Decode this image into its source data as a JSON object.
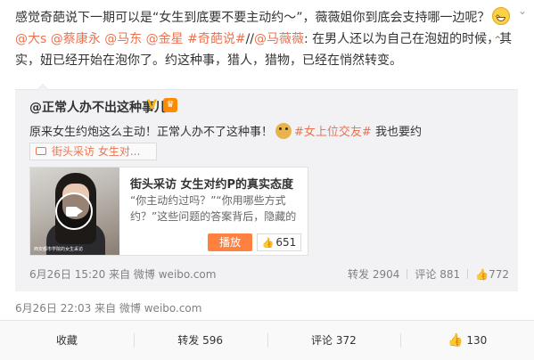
{
  "post": {
    "text_before": "感觉奇葩说下一期可以是“女生到底要不要主动约～”，薇薇姐你到底会支持哪一边呢？",
    "mentions": [
      "@大s",
      "@蔡康永",
      "@马东",
      "@金星"
    ],
    "topic": "#奇葩说#",
    "repost_sep": "//",
    "repost_user": "@马薇薇",
    "repost_text": ": 在男人还以为自己在泡妞的时候，其实，妞已经开始在泡你了。约这种事，猎人，猎物，已经在悄然转变。",
    "emoji_icon": "grin-emoji-icon",
    "time": "6月26日 22:03 来自 微博 weibo.com"
  },
  "original": {
    "author": "@正常人办不出这种事儿",
    "verified_icon": "v-verified-icon",
    "text": "原来女生约炮这么主动！正常人办不了这种事！",
    "topic": "#女上位交友#",
    "text_after": " 我也要约",
    "video_chip": "街头采访 女生对...",
    "card": {
      "title": "街头采访 女生对约P的真实态度",
      "desc": "“你主动约过吗？”“你用哪些方式约？”这些问题的答案背后，隐藏的是",
      "play_label": "播放",
      "likes": "651",
      "thumb_caption": "西安都市学院的女生采访"
    },
    "time": "6月26日 15:20 来自 微博 weibo.com",
    "repost": "转发 2904",
    "comment": "评论 881",
    "likes": "772"
  },
  "actions": {
    "favorite": "收藏",
    "repost": "转发 596",
    "comment": "评论 372",
    "like": "130"
  },
  "colors": {
    "link": "#eb7350",
    "play": "#ff8140"
  }
}
